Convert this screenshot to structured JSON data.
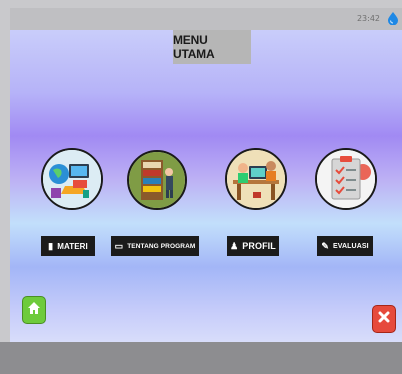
{
  "status": {
    "time": "23:42",
    "icon": "app-drop-icon"
  },
  "header": {
    "title": "MENU UTAMA"
  },
  "menu": [
    {
      "label": "MATERI",
      "icon": "book-icon"
    },
    {
      "label": "TENTANG PROGRAM",
      "icon": "laptop-icon"
    },
    {
      "label": "PROFIL",
      "icon": "user-icon"
    },
    {
      "label": "EVALUASI",
      "icon": "pencil-icon"
    }
  ],
  "nav": {
    "home": "home-icon",
    "close": "close-icon"
  },
  "colors": {
    "accent_home": "#6ecb3c",
    "accent_close": "#e64a3c",
    "label_bg": "#1b1b1b"
  }
}
